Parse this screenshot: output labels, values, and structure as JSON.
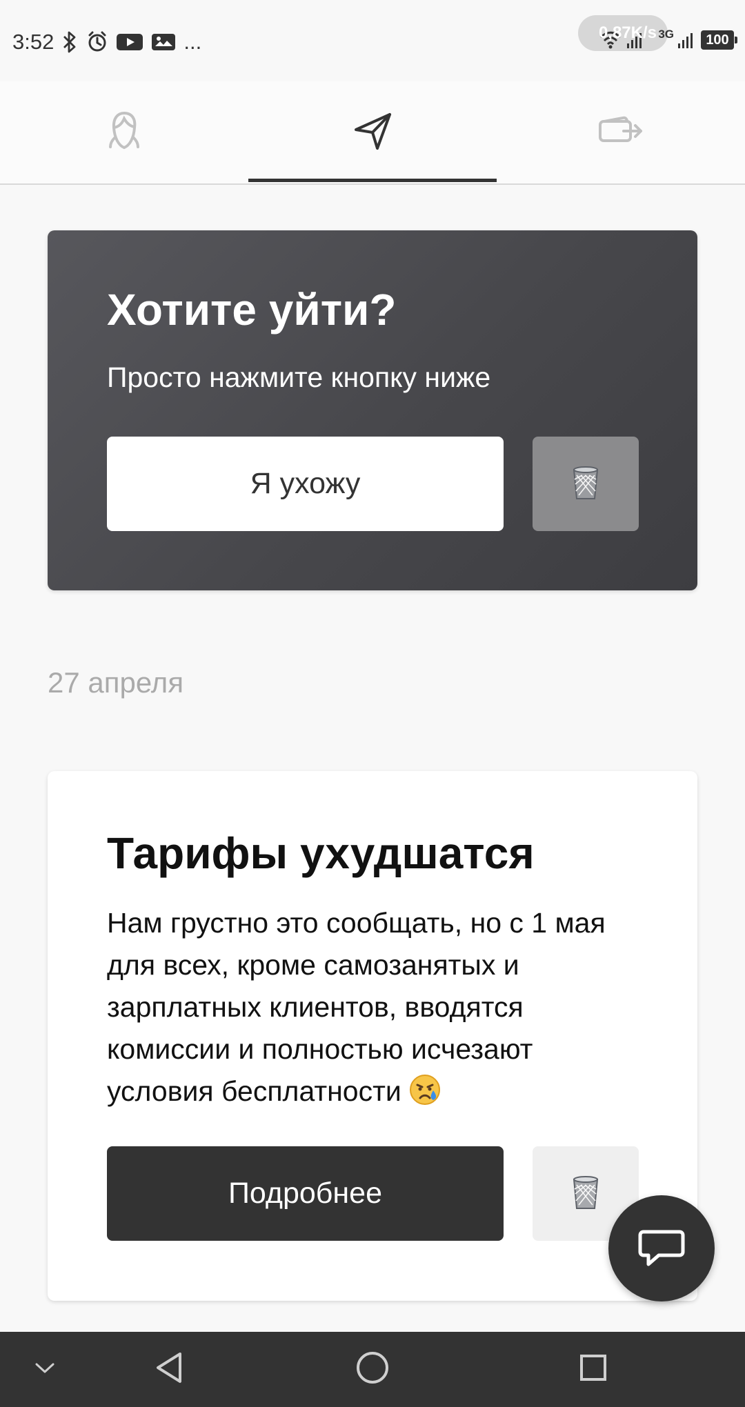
{
  "status_bar": {
    "time": "3:52",
    "more": "...",
    "network_speed": "0,87K/s",
    "network_type": "3G",
    "battery": "100",
    "icons": [
      "bluetooth-icon",
      "alarm-icon",
      "youtube-icon",
      "gallery-icon",
      "wifi-icon",
      "signal-icon"
    ]
  },
  "tabs": {
    "items": [
      {
        "icon": "profile-icon"
      },
      {
        "icon": "send-icon",
        "active": true
      },
      {
        "icon": "exit-icon"
      }
    ]
  },
  "exit_card": {
    "title": "Хотите уйти?",
    "subtitle": "Просто нажмите кнопку ниже",
    "primary_button": "Я ухожу",
    "trash_icon": "trash-icon"
  },
  "date_label": "27 апреля",
  "news_card": {
    "title": "Тарифы ухудшатся",
    "body": "Нам грустно это сообщать, но с 1 мая для всех, кроме самозанятых и зарплатных клиентов, вводятся комиссии и полностью исчезают условия бесплатности",
    "emoji": "crying-face-icon",
    "primary_button": "Подробнее",
    "trash_icon": "trash-icon"
  },
  "floating_action": {
    "icon": "chat-icon"
  },
  "navigation": {
    "items": [
      "collapse-icon",
      "back-icon",
      "home-icon",
      "recent-apps-icon"
    ]
  },
  "colors": {
    "background": "#f8f8f8",
    "dark_card": "#4f4f53",
    "primary_dark": "#333333",
    "muted_text": "#aaaaaa"
  }
}
